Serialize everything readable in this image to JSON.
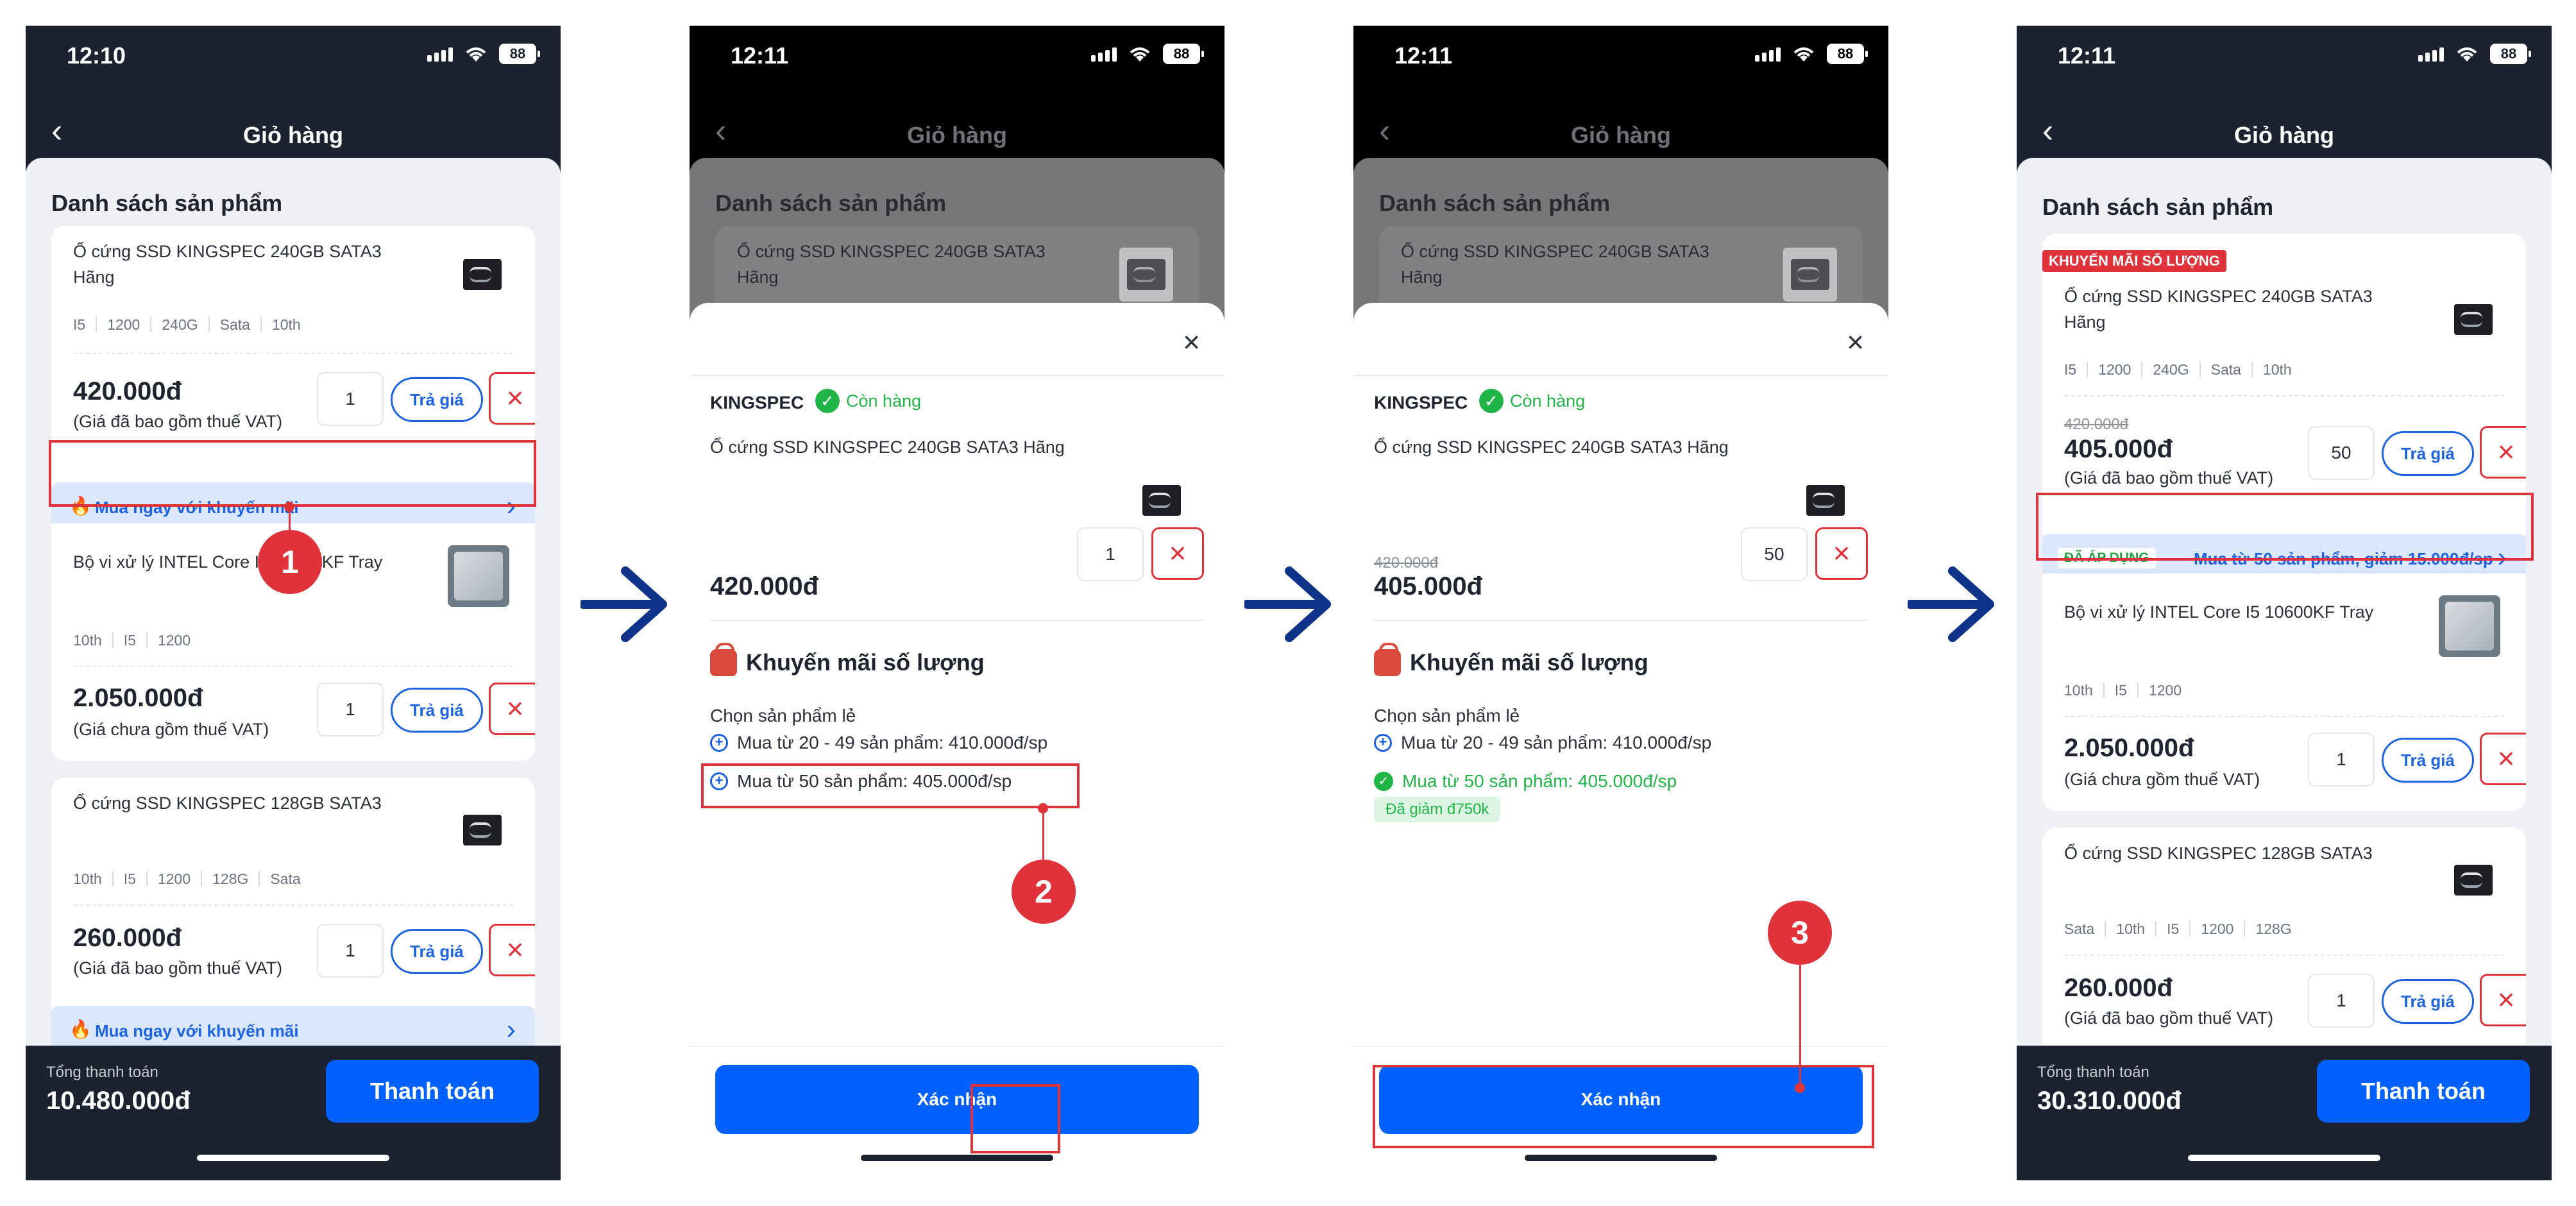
{
  "status": {
    "time1": "12:10",
    "time2": "12:11",
    "battery": "88"
  },
  "nav": {
    "title": "Giỏ hàng",
    "back": "‹"
  },
  "cart": {
    "section_title": "Danh sách sản phẩm",
    "items": [
      {
        "name_line1": "Ổ cứng SSD KINGSPEC 240GB SATA3",
        "name_line2": "Hãng",
        "specs": [
          "I5",
          "1200",
          "240G",
          "Sata",
          "10th"
        ],
        "price": "420.000đ",
        "vat": "(Giá đã bao gồm thuế VAT)",
        "qty": "1"
      },
      {
        "name_line1": "Bộ vi xử lý INTEL Core I5 10600KF Tray",
        "specs": [
          "10th",
          "I5",
          "1200"
        ],
        "price": "2.050.000đ",
        "vat": "(Giá chưa gồm thuế VAT)",
        "qty": "1"
      },
      {
        "name_line1": "Ổ cứng SSD KINGSPEC 128GB SATA3",
        "specs": [
          "10th",
          "I5",
          "1200",
          "128G",
          "Sata"
        ],
        "price": "260.000đ",
        "vat": "(Giá đã bao gồm thuế VAT)",
        "qty": "1"
      }
    ],
    "bid_label": "Trả giá",
    "promo_label": "Mua ngay với khuyến mãi",
    "footer": {
      "total_label": "Tổng thanh toán",
      "total": "10.480.000đ",
      "pay_label": "Thanh toán"
    }
  },
  "modal": {
    "brand": "KINGSPEC",
    "stock": "Còn hàng",
    "product": "Ổ cứng SSD KINGSPEC 240GB SATA3 Hãng",
    "price": "420.000đ",
    "qty_before": "1",
    "qty_after": "50",
    "old_price": "420.000đ",
    "new_price": "405.000đ",
    "promo_title": "Khuyến mãi số lượng",
    "promo_sub": "Chọn sản phẩm lẻ",
    "options": [
      "Mua từ 20 - 49 sản phẩm: 410.000đ/sp",
      "Mua từ 50 sản phẩm: 405.000đ/sp"
    ],
    "discount": "Đã giảm đ750k",
    "confirm": "Xác nhận"
  },
  "after": {
    "tag": "KHUYẾN MÃI SỐ LƯỢNG",
    "item1": {
      "name_line1": "Ổ cứng SSD KINGSPEC 240GB SATA3",
      "name_line2": "Hãng",
      "specs": [
        "I5",
        "1200",
        "240G",
        "Sata",
        "10th"
      ],
      "old_price": "420.000đ",
      "price": "405.000đ",
      "vat": "(Giá đã bao gồm thuế VAT)",
      "qty": "50"
    },
    "applied_badge": "ĐÃ ÁP DỤNG",
    "applied_text": "Mua từ 50 sản phẩm, giảm 15.000đ/sp",
    "item2": {
      "name_line1": "Bộ vi xử lý INTEL Core I5 10600KF Tray",
      "specs": [
        "10th",
        "I5",
        "1200"
      ],
      "price": "2.050.000đ",
      "vat": "(Giá chưa gồm thuế VAT)",
      "qty": "1"
    },
    "item3": {
      "name_line1": "Ổ cứng SSD KINGSPEC 128GB SATA3",
      "specs": [
        "Sata",
        "10th",
        "I5",
        "1200",
        "128G"
      ],
      "price": "260.000đ",
      "vat": "(Giá đã bao gồm thuế VAT)",
      "qty": "1"
    },
    "footer": {
      "total": "30.310.000đ"
    }
  },
  "steps": [
    "1",
    "2",
    "3"
  ],
  "colors": {
    "accent": "#0061fe",
    "danger": "#e0323a",
    "success": "#21b548",
    "dark": "#1d2230",
    "arrow": "#10338a"
  }
}
